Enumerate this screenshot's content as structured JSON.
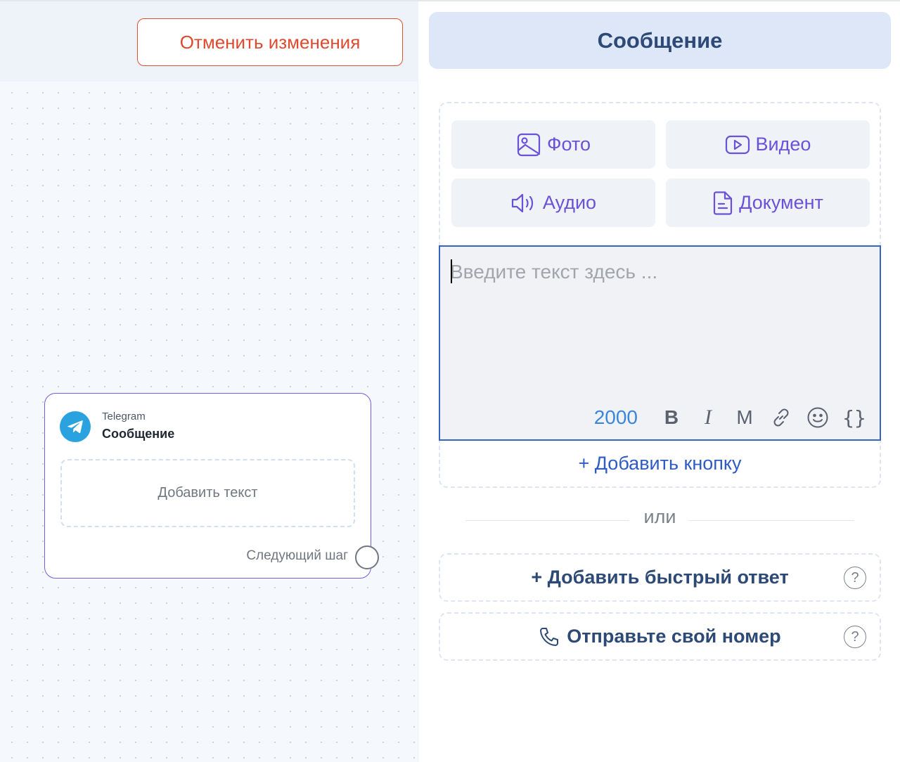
{
  "canvas": {
    "cancel_label": "Отменить изменения",
    "node": {
      "channel": "Telegram",
      "title": "Сообщение",
      "add_text_label": "Добавить текст",
      "next_step_label": "Следующий шаг"
    }
  },
  "panel": {
    "title": "Сообщение",
    "media_buttons": {
      "photo": "Фото",
      "video": "Видео",
      "audio": "Аудио",
      "document": "Документ"
    },
    "text_input": {
      "placeholder": "Введите текст здесь ...",
      "value": "",
      "char_count": "2000"
    },
    "toolbar": {
      "bold": "B",
      "italic": "I",
      "monospace": "M",
      "variables": "{}"
    },
    "add_button_label": "+ Добавить кнопку",
    "or_label": "или",
    "quick_reply_label": "+ Добавить быстрый ответ",
    "send_phone_label": "Отправьте свой номер",
    "help_symbol": "?"
  },
  "colors": {
    "accent": "#6a51d8",
    "primary_text": "#2d4a77",
    "cancel": "#dd4a2f",
    "node_border": "#6b5ee0",
    "telegram": "#2aa2e0"
  }
}
